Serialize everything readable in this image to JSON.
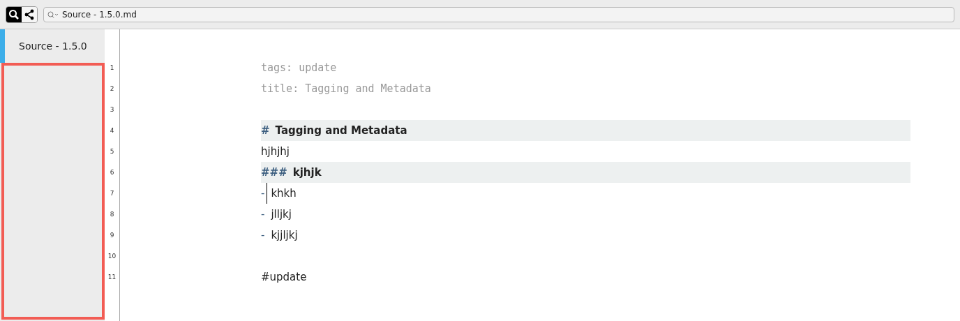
{
  "toolbar": {
    "search_field": {
      "value": "Source - 1.5.0.md"
    }
  },
  "sidebar": {
    "items": [
      {
        "label": "Source - 1.5.0",
        "selected": true
      }
    ],
    "highlighted": true
  },
  "editor": {
    "lines": [
      {
        "number": "1",
        "kind": "meta",
        "text": "tags: update",
        "cursor": false
      },
      {
        "number": "2",
        "kind": "meta",
        "text": "title: Tagging and Metadata",
        "cursor": false
      },
      {
        "number": "3",
        "kind": "blank",
        "cursor": false
      },
      {
        "number": "4",
        "kind": "heading",
        "marker": "#",
        "text": "Tagging and Metadata",
        "cursor": false
      },
      {
        "number": "5",
        "kind": "text",
        "text": "hjhjhj",
        "cursor": false
      },
      {
        "number": "6",
        "kind": "heading",
        "marker": "###",
        "text": "kjhjk",
        "cursor": false
      },
      {
        "number": "7",
        "kind": "list",
        "marker": "-",
        "text": "khkh",
        "cursor": true
      },
      {
        "number": "8",
        "kind": "list",
        "marker": "-",
        "text": "jlljkj",
        "cursor": false
      },
      {
        "number": "9",
        "kind": "list",
        "marker": "-",
        "text": "kjjljkj",
        "cursor": false
      },
      {
        "number": "10",
        "kind": "blank",
        "cursor": false
      },
      {
        "number": "11",
        "kind": "text",
        "text": "#update",
        "cursor": false
      }
    ]
  }
}
